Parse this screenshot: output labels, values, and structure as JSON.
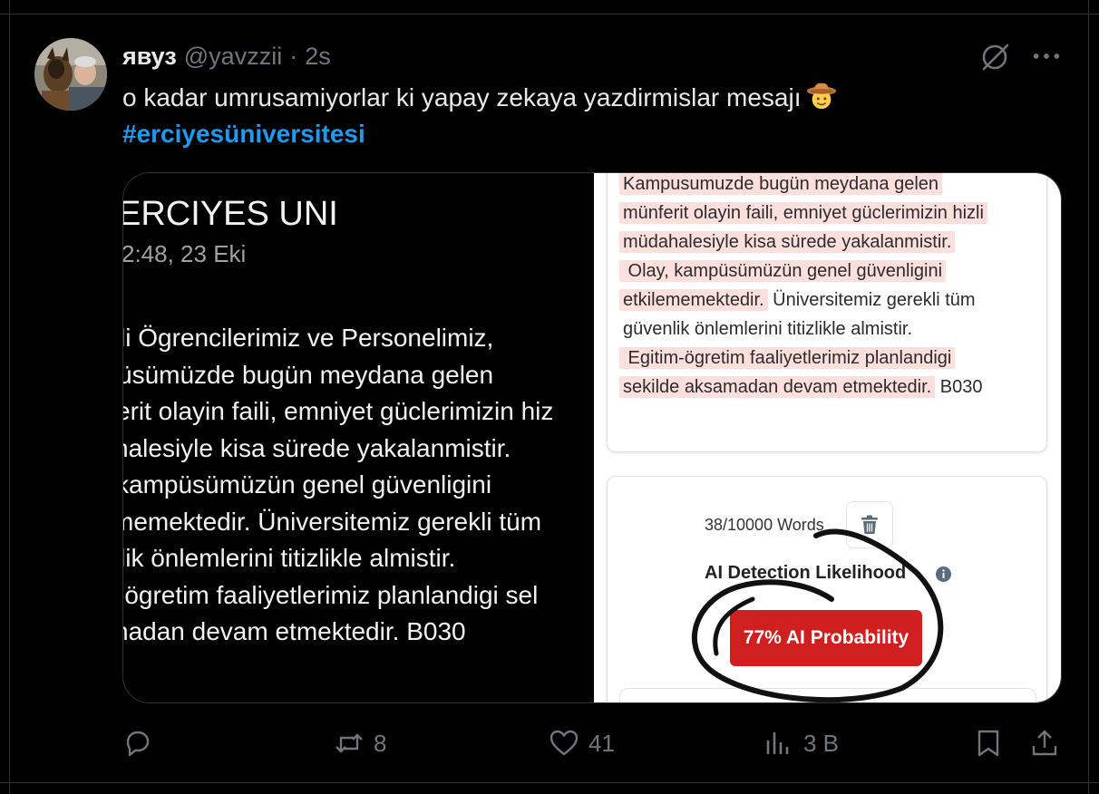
{
  "tweet": {
    "display_name": "явуз",
    "handle": "@yavzzii",
    "separator": "·",
    "time": "2s",
    "text": "o kadar umrusamiyorlar ki yapay zekaya yazdirmislar mesajı",
    "emoji_icon": "cowboy-face-icon",
    "hashtag": "#erciyesüniversitesi"
  },
  "media": {
    "left": {
      "title": "ERCIYES UNI",
      "date": "2:48, 23 Eki",
      "lines": [
        "li Ögrencilerimiz ve Personelimiz,",
        "üsümüzde bugün meydana gelen",
        "erit olayin faili, emniyet güclerimizin hiz",
        "halesiyle kisa sürede yakalanmistir.",
        "kampüsümüzün genel güvenligini",
        "memektedir. Üniversitemiz gerekli tüm",
        "lik önlemlerini titizlikle almistir.",
        "-ögretim faaliyetlerimiz planlandigi sel",
        "nadan devam etmektedir. B030"
      ]
    },
    "right": {
      "l1": "Kampusumuzde bugün meydana gelen",
      "l2": "münferit olayin faili, emniyet güclerimizin hizli",
      "l3": "müdahalesiyle kisa sürede yakalanmistir.",
      "l4": " Olay, kampüsümüzün genel güvenligini",
      "l5a": "etkilememektedir.",
      "l5b": " Üniversitemiz gerekli tüm",
      "l6": "güvenlik önlemlerini titizlikle almistir.",
      "l7": " Egitim-ögretim faaliyetlerimiz planlandigi",
      "l8a": "sekilde aksamadan devam etmektedir.",
      "l8b": " B030",
      "word_count": "38/10000 Words",
      "detection_label": "AI Detection Likelihood",
      "probability": "77% AI Probability",
      "badge_color": "#cf1f1f",
      "highlight_color": "#fde0dd"
    }
  },
  "actions": {
    "replies": "",
    "retweets": "8",
    "likes": "41",
    "views": "3 B"
  },
  "colors": {
    "accent": "#1d9bf0",
    "muted": "#71767b",
    "text": "#e7e9ea",
    "background": "#000000"
  }
}
